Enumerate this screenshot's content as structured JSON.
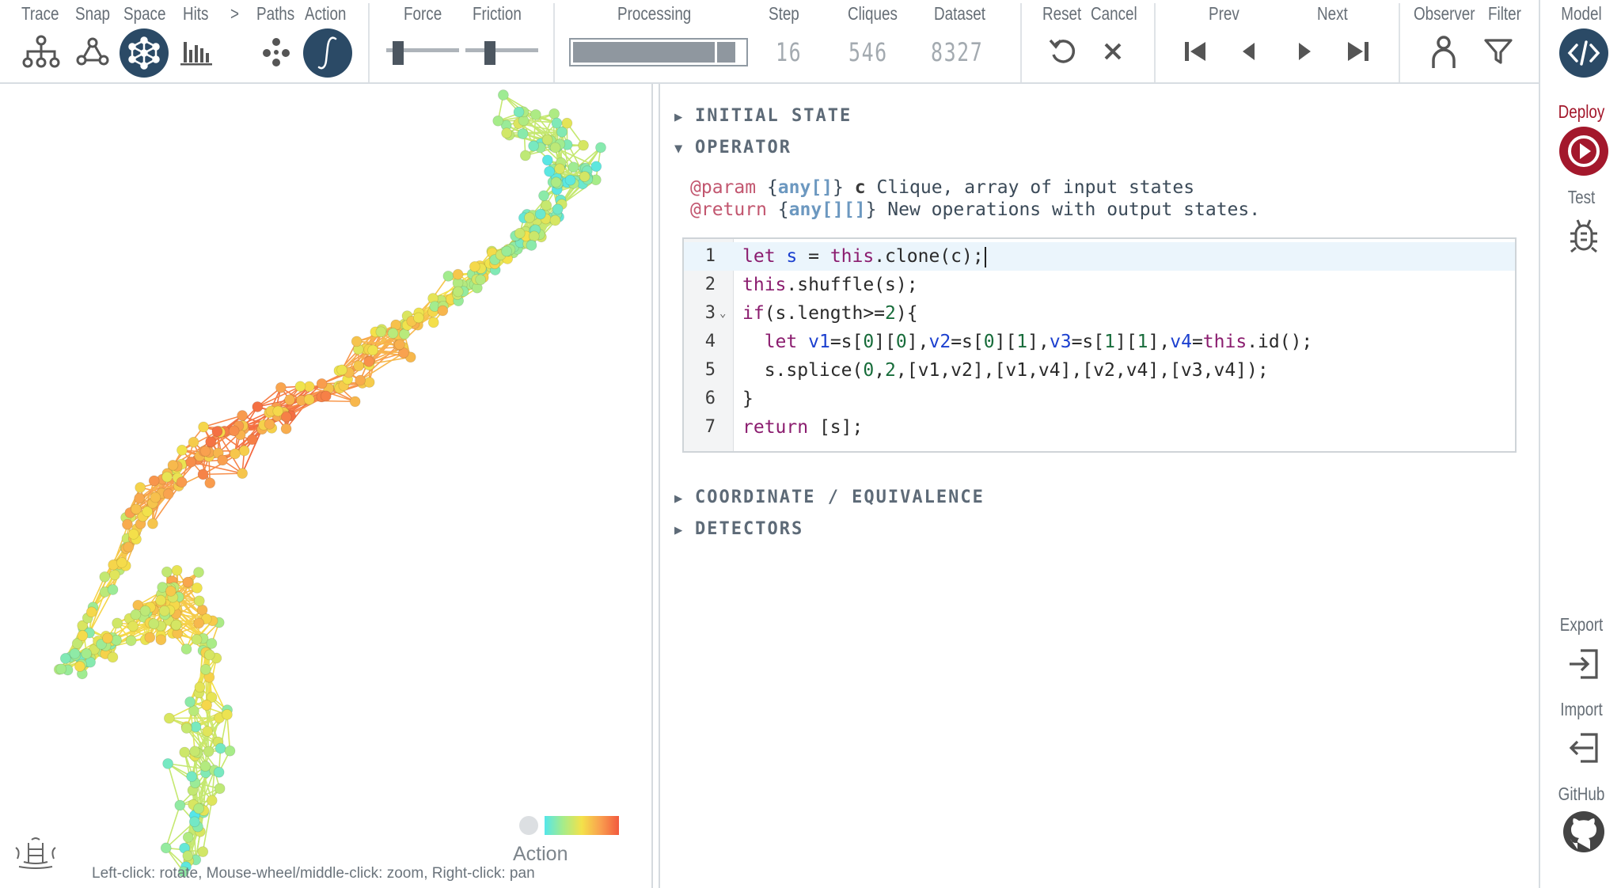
{
  "toolbar": {
    "trace_label": "Trace",
    "snap_label": "Snap",
    "space_label": "Space",
    "hits_label": "Hits",
    "more_label": ">",
    "paths_label": "Paths",
    "action_label": "Action",
    "force_label": "Force",
    "friction_label": "Friction",
    "processing_label": "Processing",
    "processing_progress": 0.95,
    "force_level": 0.1,
    "friction_level": 0.3,
    "step_label": "Step",
    "step_value": "16",
    "cliques_label": "Cliques",
    "cliques_value": "546",
    "dataset_label": "Dataset",
    "dataset_value": "8327",
    "reset_label": "Reset",
    "cancel_label": "Cancel",
    "prev_label": "Prev",
    "next_label": "Next",
    "observer_label": "Observer",
    "filter_label": "Filter",
    "accent_color": "#2b4a66"
  },
  "graph": {
    "hint": "Left-click: rotate, Mouse-wheel/middle-click: zoom, Right-click: pan",
    "legend_label": "Action"
  },
  "editor": {
    "sections": {
      "initial_state": "INITIAL STATE",
      "operator": "OPERATOR",
      "coordinate": "COORDINATE / EQUIVALENCE",
      "detectors": "DETECTORS"
    },
    "doc": {
      "param_tag": "@param",
      "param_type": "any[]",
      "param_name": "c",
      "param_desc": "Clique, array of input states",
      "return_tag": "@return",
      "return_type": "any[][]",
      "return_desc": "New operations with output states."
    },
    "line_numbers": [
      "1",
      "2",
      "3",
      "4",
      "5",
      "6",
      "7"
    ],
    "code_lines": [
      "let s = this.clone(c);",
      "this.shuffle(s);",
      "if(s.length>=2){",
      "  let v1=s[0][0],v2=s[0][1],v3=s[1][1],v4=this.id();",
      "  s.splice(0,2,[v1,v2],[v1,v4],[v2,v4],[v3,v4]);",
      "}",
      "return [s];"
    ]
  },
  "sidebar": {
    "model_label": "Model",
    "deploy_label": "Deploy",
    "test_label": "Test",
    "export_label": "Export",
    "import_label": "Import",
    "github_label": "GitHub",
    "deploy_color": "#a3182c"
  }
}
